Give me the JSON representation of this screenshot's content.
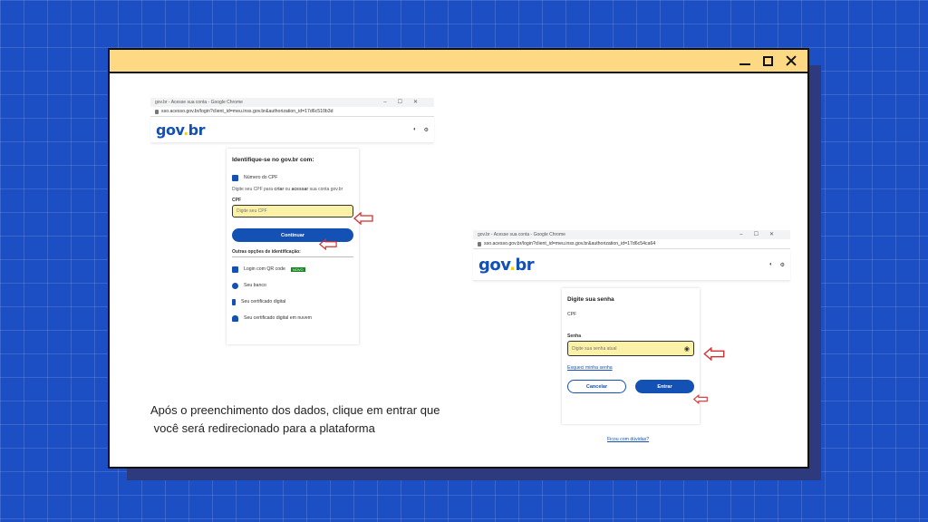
{
  "colors": {
    "background": "#1d4fc4",
    "titlebar": "#fcd982",
    "gov_blue": "#1351b4",
    "highlight_field": "#fbf2a8",
    "arrow_red": "#d32f2f"
  },
  "window_controls": {
    "minimize_icon": "minimize-icon",
    "maximize_icon": "maximize-icon",
    "close_icon": "close-icon"
  },
  "shot1": {
    "chrome_title": "gov.br - Acesse sua conta - Google Chrome",
    "url": "sso.acesso.gov.br/login?client_id=meu.inss.gov.br&authorization_id=17d6c510b3d",
    "logo": {
      "g": "gov",
      "o": ".",
      "b": "br"
    },
    "header_icons": [
      "◐",
      "⚙"
    ],
    "card_title": "Identifique-se no gov.br com:",
    "cpf_option": "Número do CPF",
    "instruction_pre": "Digite seu CPF para ",
    "instruction_b1": "criar",
    "instruction_mid": " ou ",
    "instruction_b2": "acessar",
    "instruction_post": " sua conta gov.br",
    "cpf_label": "CPF",
    "cpf_placeholder": "Digite seu CPF",
    "continue_button": "Continuar",
    "other_options_title": "Outras opções de identificação:",
    "options": [
      {
        "label": "Login com QR code",
        "badge": "NOVO"
      },
      {
        "label": "Seu banco"
      },
      {
        "label": "Seu certificado digital"
      },
      {
        "label": "Seu certificado digital em nuvem"
      }
    ]
  },
  "shot2": {
    "chrome_title": "gov.br - Acesse sua conta - Google Chrome",
    "url": "sso.acesso.gov.br/login?client_id=meu.inss.gov.br&authorization_id=17d6c54ca64",
    "logo": {
      "g": "gov",
      "o": ".",
      "b": "br"
    },
    "header_icons": [
      "◐",
      "⚙"
    ],
    "card_title": "Digite sua senha",
    "cpf_label": "CPF",
    "password_label": "Senha",
    "password_placeholder": "Digite sua senha atual",
    "forgot_link": "Esqueci minha senha",
    "cancel_button": "Cancelar",
    "enter_button": "Entrar",
    "help_link": "Ficou com dúvidas?"
  },
  "caption": {
    "line1": "Após o preenchimento dos dados, clique em entrar que",
    "line2": " você será redirecionado para a plataforma"
  }
}
